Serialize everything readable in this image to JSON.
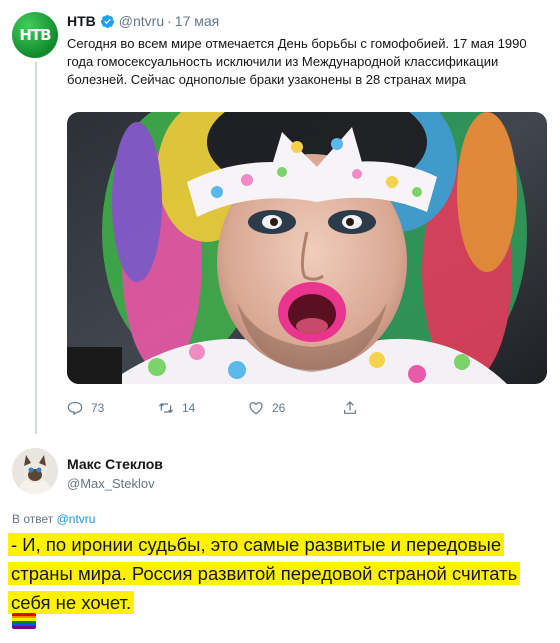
{
  "tweet": {
    "author_name": "НТВ",
    "author_handle": "@ntvru",
    "separator": "·",
    "date": "17 мая",
    "avatar_text": "НТВ",
    "text": "Сегодня во всем мире отмечается День борьбы с гомофобией. 17 мая 1990 года гомосексуальность исключили из Международной классификации болезней. Сейчас однополые браки узаконены в 28 странах мира",
    "actions": {
      "replies": "73",
      "retweets": "14",
      "likes": "26"
    }
  },
  "reply": {
    "author_name": "Макс Стеклов",
    "author_handle": "@Max_Steklov",
    "reply_prefix": "В ответ",
    "reply_to": "@ntvru",
    "text": "- И, по иронии судьбы, это самые развитые и передовые страны мира. Россия развитой передовой страной считать себя не хочет."
  },
  "colors": {
    "link": "#1b95e0",
    "muted": "#657786",
    "highlight": "#fff200",
    "ntv_green": "#1aa33a"
  },
  "icons": [
    "verified-icon",
    "reply-icon",
    "retweet-icon",
    "like-icon",
    "share-icon",
    "rainbow-flag-icon"
  ]
}
